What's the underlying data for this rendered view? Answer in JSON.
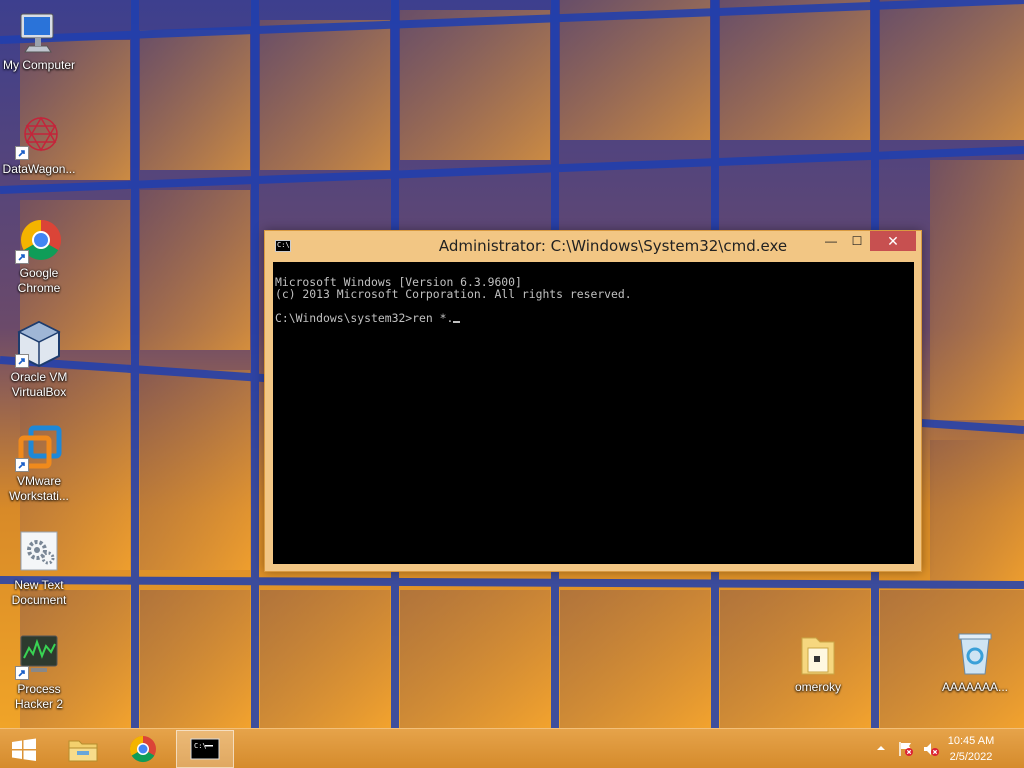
{
  "desktop": {
    "icons": [
      {
        "label": "My Computer"
      },
      {
        "label": "DataWagon..."
      },
      {
        "label": "Google\nChrome"
      },
      {
        "label": "Oracle VM\nVirtualBox"
      },
      {
        "label": "VMware\nWorkstati..."
      },
      {
        "label": "New Text\nDocument"
      },
      {
        "label": "Process\nHacker 2"
      },
      {
        "label": "omeroky"
      },
      {
        "label": "AAAAAAA..."
      }
    ]
  },
  "cmd_window": {
    "title": "Administrator: C:\\Windows\\System32\\cmd.exe",
    "icon_text": "C:\\",
    "minimize_glyph": "—",
    "maximize_glyph": "☐",
    "close_glyph": "✕",
    "lines": [
      "Microsoft Windows [Version 6.3.9600]",
      "(c) 2013 Microsoft Corporation. All rights reserved.",
      "",
      "C:\\Windows\\system32>ren *."
    ]
  },
  "taskbar": {
    "buttons": [
      {
        "name": "start",
        "icon": "windows-logo-icon"
      },
      {
        "name": "file-explorer",
        "icon": "folder-icon"
      },
      {
        "name": "chrome",
        "icon": "chrome-icon"
      },
      {
        "name": "cmd",
        "icon": "cmd-icon",
        "active": true
      }
    ],
    "tray": {
      "time": "10:45 AM",
      "date": "2/5/2022"
    }
  },
  "colors": {
    "taskbar": "#dc952f",
    "window_frame": "#f2c684",
    "close_button": "#c75050",
    "console_bg": "#000000",
    "console_text": "#c0c0c0"
  }
}
